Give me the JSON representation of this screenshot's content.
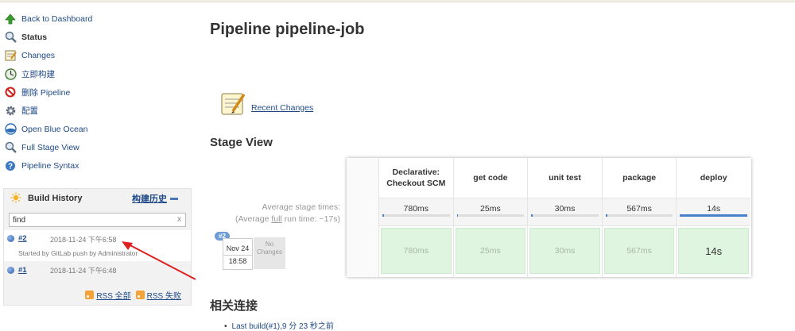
{
  "sidebar": {
    "items": [
      {
        "label": "Back to Dashboard",
        "icon": "up-arrow-icon"
      },
      {
        "label": "Status",
        "icon": "magnifier-icon"
      },
      {
        "label": "Changes",
        "icon": "notepad-icon"
      },
      {
        "label": "立即构建",
        "icon": "build-clock-icon"
      },
      {
        "label": "删除 Pipeline",
        "icon": "no-entry-icon"
      },
      {
        "label": "配置",
        "icon": "gear-icon"
      },
      {
        "label": "Open Blue Ocean",
        "icon": "blue-ocean-icon"
      },
      {
        "label": "Full Stage View",
        "icon": "magnifier-icon"
      },
      {
        "label": "Pipeline Syntax",
        "icon": "help-icon"
      }
    ]
  },
  "build_history": {
    "title": "Build History",
    "trend": "构建历史",
    "filter_value": "find",
    "filter_clear": "x",
    "builds": [
      {
        "num": "#2",
        "date": "2018-11-24 下午6:58",
        "cause": "Started by GitLab push by Administrator"
      },
      {
        "num": "#1",
        "date": "2018-11-24 下午6:48"
      }
    ],
    "rss_all": "RSS 全部",
    "rss_failed": "RSS 失败"
  },
  "main": {
    "title": "Pipeline pipeline-job",
    "recent_changes": "Recent Changes",
    "stage_view_title": "Stage View",
    "avg_line1": "Average stage times:",
    "avg_line2_pre": "(Average ",
    "avg_line2_u": "full",
    "avg_line2_post": " run time: ~17s)",
    "stages": [
      {
        "name": "Declarative: Checkout SCM",
        "avg": "780ms",
        "bar_fraction": 0.02,
        "run": "780ms"
      },
      {
        "name": "get code",
        "avg": "25ms",
        "bar_fraction": 0.01,
        "run": "25ms"
      },
      {
        "name": "unit test",
        "avg": "30ms",
        "bar_fraction": 0.01,
        "run": "30ms"
      },
      {
        "name": "package",
        "avg": "567ms",
        "bar_fraction": 0.03,
        "run": "567ms"
      },
      {
        "name": "deploy",
        "avg": "14s",
        "bar_fraction": 1.0,
        "run": "14s"
      }
    ],
    "run": {
      "badge": "#2",
      "date": "Nov 24",
      "time": "18:58",
      "no_changes": "No Changes"
    },
    "related_title": "相关连接",
    "related_links": [
      "Last build(#1),9 分 23 秒之前"
    ]
  },
  "colors": {
    "link": "#204a87",
    "success_cell": "#dff5df",
    "bar": "#4a7fc9",
    "rss": "#f4a23a"
  }
}
